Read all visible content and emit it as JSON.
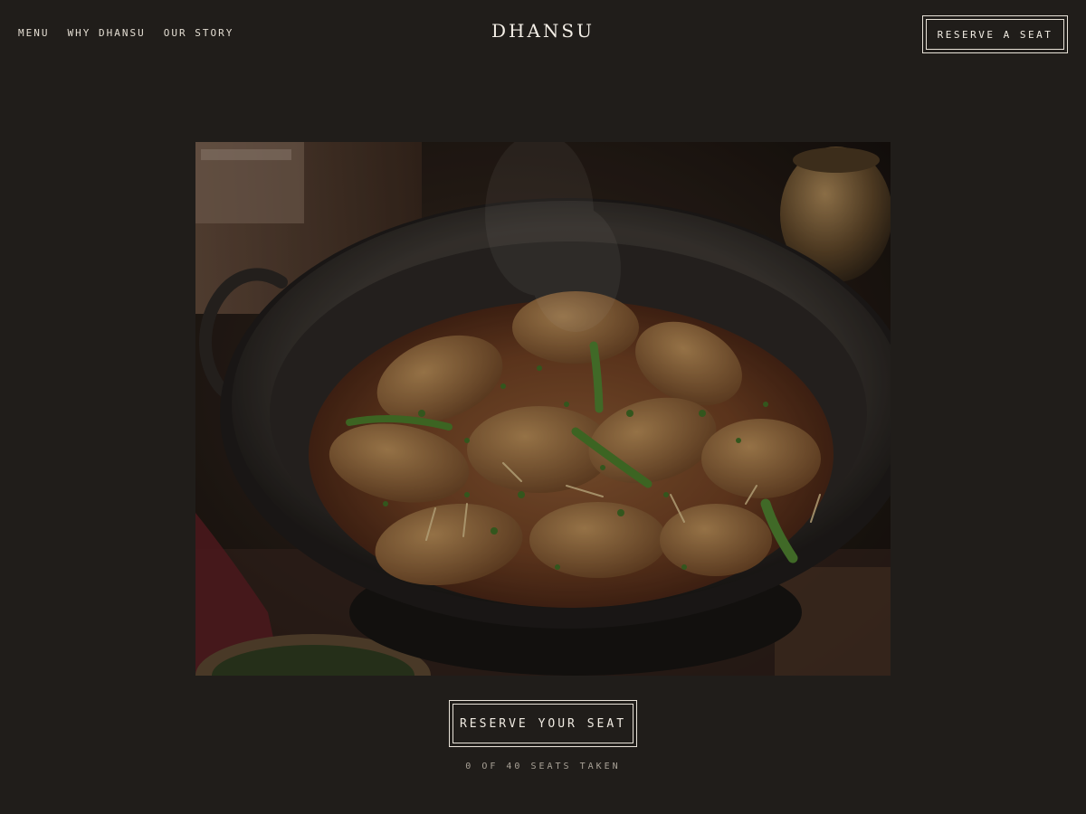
{
  "nav": {
    "items": [
      "MENU",
      "WHY DHANSU",
      "OUR STORY"
    ]
  },
  "brand": {
    "name": "DHANSU"
  },
  "header": {
    "cta_label": "RESERVE A SEAT"
  },
  "hero": {
    "image_alt": "Karahi curry in an iron wok"
  },
  "reservation": {
    "cta_label": "RESERVE YOUR SEAT",
    "seats_status": "0 OF 40 SEATS TAKEN",
    "seats_taken": 0,
    "seats_total": 40
  },
  "colors": {
    "background": "#201d1a",
    "text": "#e8e2d8"
  }
}
